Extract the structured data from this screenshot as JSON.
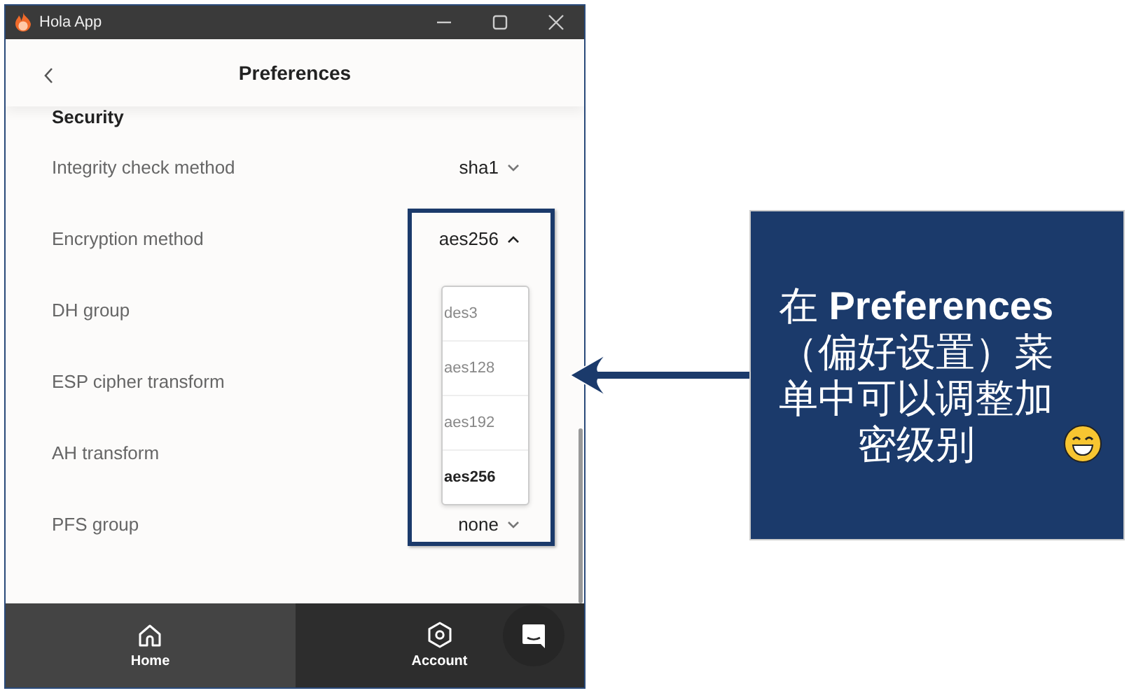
{
  "window": {
    "title": "Hola App"
  },
  "header": {
    "title": "Preferences"
  },
  "section": {
    "title": "Security"
  },
  "settings": [
    {
      "label": "Integrity check method",
      "value": "sha1",
      "expanded": false
    },
    {
      "label": "Encryption method",
      "value": "aes256",
      "expanded": true,
      "options": [
        {
          "label": "des3",
          "selected": false
        },
        {
          "label": "aes128",
          "selected": false
        },
        {
          "label": "aes192",
          "selected": false
        },
        {
          "label": "aes256",
          "selected": true
        }
      ]
    },
    {
      "label": "DH group"
    },
    {
      "label": "ESP cipher transform"
    },
    {
      "label": "AH transform"
    },
    {
      "label": "PFS group",
      "value": "none",
      "expanded": false
    }
  ],
  "nav": [
    {
      "label": "Home",
      "selected": true
    },
    {
      "label": "Account",
      "selected": false
    }
  ],
  "callout": {
    "text": "在 **Preferences**（偏好设置）菜单中可以调整加密级别"
  }
}
